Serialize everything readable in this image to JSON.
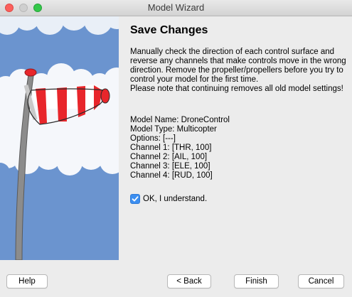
{
  "window": {
    "title": "Model Wizard"
  },
  "page": {
    "heading": "Save Changes",
    "description": "Manually check the direction of each control surface and reverse any channels that make controls move in the wrong direction. Remove the propeller/propellers before you try to control your model for the first time.\nPlease note that continuing removes all old model settings!",
    "details": [
      "Model Name: DroneControl",
      "Model Type: Multicopter",
      "Options: [---]",
      "Channel 1: [THR, 100]",
      "Channel 2: [AIL, 100]",
      "Channel 3: [ELE, 100]",
      "Channel 4: [RUD, 100]"
    ],
    "acknowledge": {
      "label": "OK, I understand.",
      "checked": true
    }
  },
  "buttons": {
    "help": "Help",
    "back": "< Back",
    "finish": "Finish",
    "cancel": "Cancel"
  },
  "colors": {
    "sky": "#6b94cf",
    "cloud": "#ffffff",
    "stripe_red": "#e8262b",
    "accent": "#3b8ef0"
  }
}
